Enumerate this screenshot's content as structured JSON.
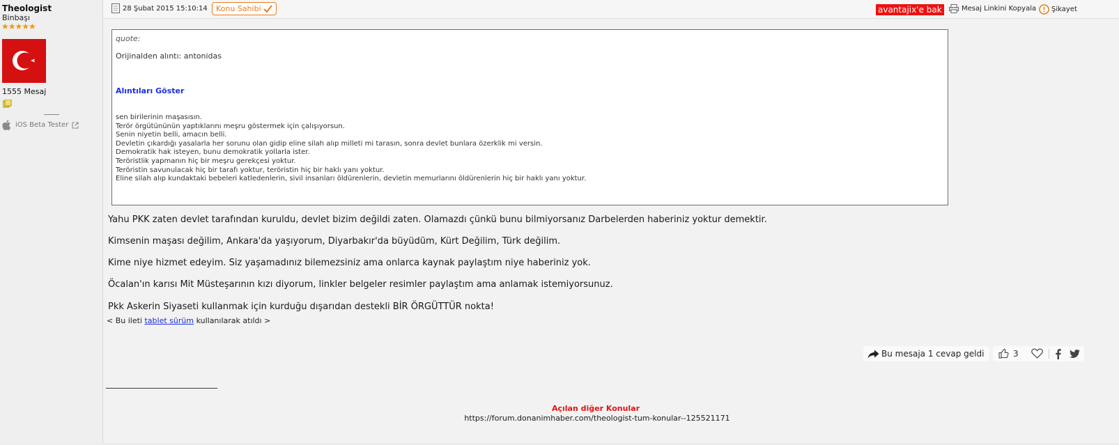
{
  "user": {
    "name": "Theologist",
    "rank": "Binbaşı",
    "stars": "★★★★★",
    "message_count": "1555 Mesaj",
    "badge_text": "iOS Beta Tester"
  },
  "header": {
    "date": "28 Şubat 2015 15:10:14",
    "topic_owner": "Konu Sahibi",
    "avantaj": "avantajix'e bak",
    "copy_link": "Mesaj Linkini Kopyala",
    "complain": "Şikayet"
  },
  "quote": {
    "label": "quote:",
    "origin": "Orijinalden alıntı: antonidas",
    "show_quotes": "Alıntıları Göster",
    "lines": [
      "sen birilerinin maşasısın.",
      "Terör örgütününün yaptıklarını meşru göstermek için çalışıyorsun.",
      "Senin niyetin belli, amacın belli.",
      "Devletin çıkardığı yasalarla her sorunu olan gidip eline silah alıp milleti mi tarasın, sonra devlet bunlara özerklik mi versin.",
      "Demokratik hak isteyen, bunu demokratik yollarla ister.",
      "Teröristlik yapmanın hiç bir meşru gerekçesi yoktur.",
      "Teröristin savunulacak hiç bir tarafı yoktur, teröristin hiç bir haklı yanı yoktur.",
      "Eline silah alıp kundaktaki bebeleri katledenlerin, sivil insanları öldürenlerin, devletin memurlarını öldürenlerin hiç bir haklı yanı yoktur."
    ]
  },
  "body": {
    "paragraphs": [
      "Yahu PKK zaten devlet tarafından kuruldu, devlet bizim değildi zaten. Olamazdı çünkü bunu bilmiyorsanız Darbelerden haberiniz yoktur demektir.",
      "Kimsenin maşası değilim, Ankara'da yaşıyorum, Diyarbakır'da büyüdüm, Kürt Değilim, Türk değilim.",
      "Kime niye hizmet edeyim. Siz yaşamadınız bilemezsiniz ama onlarca kaynak paylaştım niye haberiniz yok.",
      "Öcalan'ın karısı Mit Müsteşarının kızı diyorum, linkler belgeler resimler paylaştım ama anlamak istemiyorsunuz.",
      "Pkk Askerin Siyaseti kullanmak için kurduğu dışarıdan destekli BİR ÖRGÜTTÜR nokta!"
    ],
    "tablet_prefix": "< Bu ileti",
    "tablet_link": "tablet sürüm",
    "tablet_suffix": "kullanılarak atıldı >"
  },
  "actions": {
    "reply_text": "Bu mesaja 1 cevap geldi",
    "like_count": "3"
  },
  "signature": {
    "line": "_____________________________",
    "title": "Açılan diğer Konular",
    "url": "https://forum.donanimhaber.com/theologist-tum-konular--125521171"
  },
  "colors": {
    "accent_orange": "#e87d1e",
    "avantaj_red": "#ee1111",
    "link_blue": "#1a2fe0",
    "signature_red": "#e41414"
  },
  "icons": [
    "calendar-icon",
    "check-icon",
    "printer-icon",
    "warning-icon",
    "apple-icon",
    "external-link-icon",
    "reply-arrow-icon",
    "thumbs-up-icon",
    "heart-icon",
    "facebook-icon",
    "twitter-icon"
  ]
}
